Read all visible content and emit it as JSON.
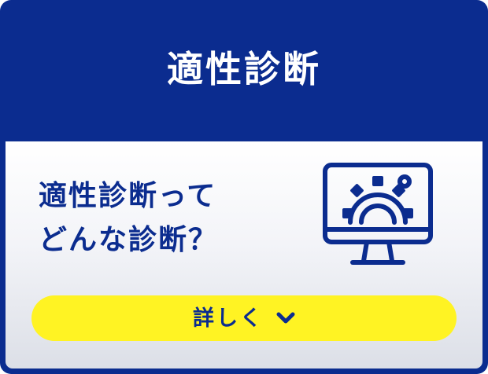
{
  "card": {
    "title": "適性診断",
    "question_line_1": "適性診断って",
    "question_line_2": "どんな診断？",
    "details_label": "詳しく",
    "icons": {
      "monitor": "monitor-gear-icon",
      "chevron": "chevron-down-icon"
    },
    "colors": {
      "navy": "#0b2c8f",
      "yellow": "#fff323",
      "white": "#ffffff"
    }
  }
}
